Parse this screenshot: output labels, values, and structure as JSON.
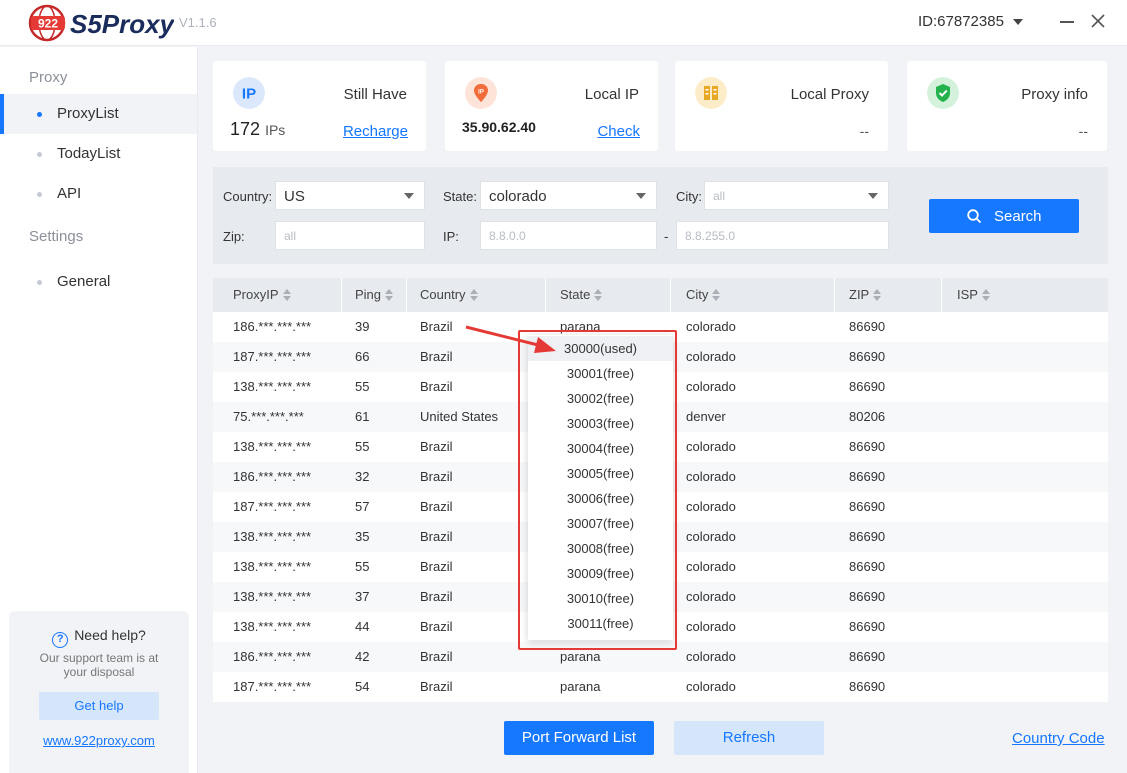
{
  "app": {
    "logo_badge": "922",
    "logo_text": "S5Proxy",
    "version": "V1.1.6",
    "account_id": "ID:67872385"
  },
  "colors": {
    "primary": "#1677ff",
    "light_button": "#d5e6fb",
    "annotation": "#e53935"
  },
  "sidebar": {
    "section_proxy": "Proxy",
    "items": [
      {
        "label": "ProxyList",
        "active": true
      },
      {
        "label": "TodayList",
        "active": false
      },
      {
        "label": "API",
        "active": false
      }
    ],
    "section_settings": "Settings",
    "settings_items": [
      {
        "label": "General"
      }
    ],
    "help": {
      "title": "Need help?",
      "text_line1": "Our support team is at",
      "text_line2": "your disposal",
      "button": "Get help",
      "link": "www.922proxy.com"
    }
  },
  "cards": {
    "still_have": {
      "icon_text": "IP",
      "title": "Still Have",
      "count": "172",
      "unit": "IPs",
      "action": "Recharge"
    },
    "local_ip": {
      "icon_text": "IP",
      "title": "Local IP",
      "value": "35.90.62.40",
      "action": "Check"
    },
    "local_proxy": {
      "title": "Local Proxy",
      "value": "--"
    },
    "proxy_info": {
      "title": "Proxy info",
      "value": "--"
    }
  },
  "filter": {
    "country_label": "Country:",
    "country_value": "US",
    "state_label": "State:",
    "state_value": "colorado",
    "city_label": "City:",
    "city_placeholder": "all",
    "zip_label": "Zip:",
    "zip_placeholder": "all",
    "ip_label": "IP:",
    "ip_from_placeholder": "8.8.0.0",
    "ip_separator": "-",
    "ip_to_placeholder": "8.8.255.0",
    "search_button": "Search"
  },
  "table": {
    "columns": [
      "ProxyIP",
      "Ping",
      "Country",
      "State",
      "City",
      "ZIP",
      "ISP"
    ],
    "rows": [
      [
        "186.***.***.***",
        "39",
        "Brazil",
        "parana",
        "colorado",
        "86690",
        ""
      ],
      [
        "187.***.***.***",
        "66",
        "Brazil",
        "",
        "colorado",
        "86690",
        ""
      ],
      [
        "138.***.***.***",
        "55",
        "Brazil",
        "",
        "colorado",
        "86690",
        ""
      ],
      [
        "75.***.***.***",
        "61",
        "United States",
        "",
        "denver",
        "80206",
        ""
      ],
      [
        "138.***.***.***",
        "55",
        "Brazil",
        "",
        "colorado",
        "86690",
        ""
      ],
      [
        "186.***.***.***",
        "32",
        "Brazil",
        "",
        "colorado",
        "86690",
        ""
      ],
      [
        "187.***.***.***",
        "57",
        "Brazil",
        "",
        "colorado",
        "86690",
        ""
      ],
      [
        "138.***.***.***",
        "35",
        "Brazil",
        "",
        "colorado",
        "86690",
        ""
      ],
      [
        "138.***.***.***",
        "55",
        "Brazil",
        "",
        "colorado",
        "86690",
        ""
      ],
      [
        "138.***.***.***",
        "37",
        "Brazil",
        "",
        "colorado",
        "86690",
        ""
      ],
      [
        "138.***.***.***",
        "44",
        "Brazil",
        "",
        "colorado",
        "86690",
        ""
      ],
      [
        "186.***.***.***",
        "42",
        "Brazil",
        "parana",
        "colorado",
        "86690",
        ""
      ],
      [
        "187.***.***.***",
        "54",
        "Brazil",
        "parana",
        "colorado",
        "86690",
        ""
      ]
    ]
  },
  "port_dropdown": {
    "items": [
      "30000(used)",
      "30001(free)",
      "30002(free)",
      "30003(free)",
      "30004(free)",
      "30005(free)",
      "30006(free)",
      "30007(free)",
      "30008(free)",
      "30009(free)",
      "30010(free)",
      "30011(free)"
    ],
    "selected_index": 0
  },
  "footer": {
    "port_forward_button": "Port Forward List",
    "refresh_button": "Refresh",
    "country_code_link": "Country Code"
  }
}
